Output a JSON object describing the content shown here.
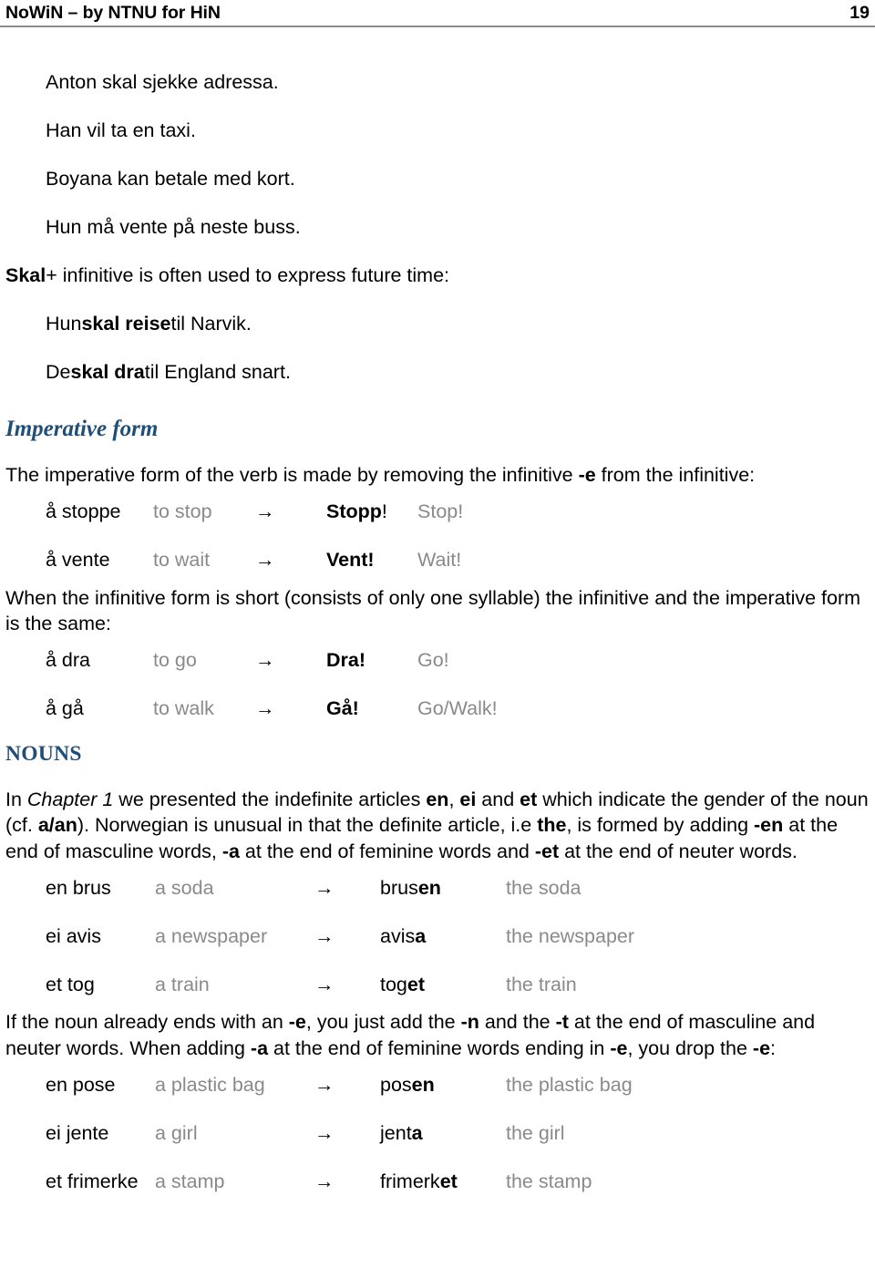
{
  "header": {
    "title": "NoWiN – by NTNU for HiN",
    "page_number": "19"
  },
  "examples_modal": [
    "Anton skal sjekke adressa.",
    "Han vil ta en taxi.",
    "Boyana kan betale med kort.",
    "Hun må vente på neste buss."
  ],
  "skal_section": {
    "intro_bold": "Skal",
    "intro_rest": " + infinitive is often used to express future time:",
    "examples": [
      {
        "pre": "Hun ",
        "bold": "skal reise",
        "post": " til Narvik."
      },
      {
        "pre": "De ",
        "bold": "skal dra",
        "post": " til England snart."
      }
    ]
  },
  "imperative_section": {
    "heading": "Imperative form",
    "intro_a": "The imperative form of the verb is made by removing the infinitive ",
    "intro_bold": "-e",
    "intro_b": " from the infinitive:",
    "rows": [
      {
        "native": "å stoppe",
        "gloss": "to stop",
        "arrow": "→",
        "result_bold": "Stopp",
        "result_plain": "!",
        "result_gloss": "Stop!"
      },
      {
        "native": "å vente",
        "gloss": "to wait",
        "arrow": "→",
        "result_bold": "Vent!",
        "result_plain": "",
        "result_gloss": "Wait!"
      }
    ],
    "short_note_line1": "When the infinitive form is short (consists of only one syllable) the infinitive and the imperative form",
    "short_note_line2": "is the same:",
    "short_rows": [
      {
        "native": "å dra",
        "gloss": "to go",
        "arrow": "→",
        "result_bold": "Dra!",
        "result_plain": "",
        "result_gloss": "Go!"
      },
      {
        "native": "å gå",
        "gloss": "to walk",
        "arrow": "→",
        "result_bold": "Gå!",
        "result_plain": "",
        "result_gloss": "Go/Walk!"
      }
    ]
  },
  "nouns_section": {
    "heading": "NOUNS",
    "intro": {
      "t1": "In ",
      "italic1": "Chapter 1",
      "t2": " we presented the indefinite articles ",
      "b1": "en",
      "t3": ", ",
      "b2": "ei",
      "t4": " and ",
      "b3": "et",
      "t5": " which indicate the gender of the noun (cf. ",
      "b4": "a/an",
      "t6": "). Norwegian is unusual in that the definite article, i.e ",
      "b5": "the",
      "t7": ", is formed by adding ",
      "b6": "-en",
      "t8": " at the end of masculine words, ",
      "b7": "-a",
      "t9": " at the end of feminine words and ",
      "b8": "-et",
      "t10": " at the end of neuter words."
    },
    "rows": [
      {
        "native": "en brus",
        "gloss": "a soda",
        "arrow": "→",
        "stem": "brus",
        "suffix": "en",
        "result_gloss": "the soda"
      },
      {
        "native": "ei avis",
        "gloss": "a newspaper",
        "arrow": "→",
        "stem": "avis",
        "suffix": "a",
        "result_gloss": "the newspaper"
      },
      {
        "native": "et tog",
        "gloss": "a train",
        "arrow": "→",
        "stem": "tog",
        "suffix": "et",
        "result_gloss": "the train"
      }
    ],
    "e_rule": {
      "t1": "If the noun already ends with an ",
      "b1": "-e",
      "t2": ", you just add the ",
      "b2": "-n",
      "t3": " and the ",
      "b3": "-t",
      "t4": " at the end of masculine and neuter words. When adding ",
      "b4": "-a",
      "t5": " at the end of feminine words ending in ",
      "b5": "-e",
      "t6": ", you drop the ",
      "b6": "-e",
      "t7": ":"
    },
    "e_rows": [
      {
        "native": "en pose",
        "gloss": "a plastic bag",
        "arrow": "→",
        "stem": "pos",
        "suffix": "en",
        "result_gloss": "the plastic bag"
      },
      {
        "native": "ei jente",
        "gloss": "a girl",
        "arrow": "→",
        "stem": "jent",
        "suffix": "a",
        "result_gloss": "the girl"
      },
      {
        "native": "et frimerke",
        "gloss": "a stamp",
        "arrow": "→",
        "stem": "frimerk",
        "suffix": "et",
        "result_gloss": "the stamp"
      }
    ]
  },
  "colors": {
    "heading_blue": "#1f4e79",
    "gloss_gray": "#8a8a8a",
    "rule_gray": "#8c8c8c"
  }
}
